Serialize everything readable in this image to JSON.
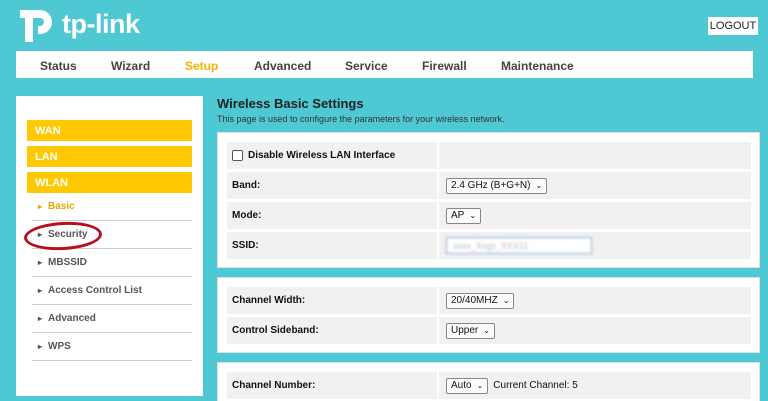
{
  "brand": {
    "name": "tp-link"
  },
  "header": {
    "logout_label": "LOGOUT"
  },
  "nav": {
    "items": [
      "Status",
      "Wizard",
      "Setup",
      "Advanced",
      "Service",
      "Firewall",
      "Maintenance"
    ],
    "active": "Setup"
  },
  "sidebar": {
    "main_items": [
      "WAN",
      "LAN",
      "WLAN"
    ],
    "sub_items": [
      "Basic",
      "Security",
      "MBSSID",
      "Access Control List",
      "Advanced",
      "WPS"
    ],
    "active_sub": "Basic",
    "highlighted_sub": "Security"
  },
  "content": {
    "title": "Wireless Basic Settings",
    "description": "This page is used to configure the parameters for your wireless network.",
    "disable_label": "Disable Wireless LAN Interface",
    "band_label": "Band:",
    "band_value": "2.4 GHz (B+G+N)",
    "mode_label": "Mode:",
    "mode_value": "AP",
    "ssid_label": "SSID:",
    "ssid_value": "xxxx_Xxgz_XXX11",
    "channel_width_label": "Channel Width:",
    "channel_width_value": "20/40MHZ",
    "control_sideband_label": "Control Sideband:",
    "control_sideband_value": "Upper",
    "channel_number_label": "Channel Number:",
    "channel_number_value": "Auto",
    "current_channel_text": "Current Channel: 5"
  },
  "colors": {
    "background": "#4ec9d4",
    "accent": "#ffc800",
    "annotation": "#b51020"
  }
}
